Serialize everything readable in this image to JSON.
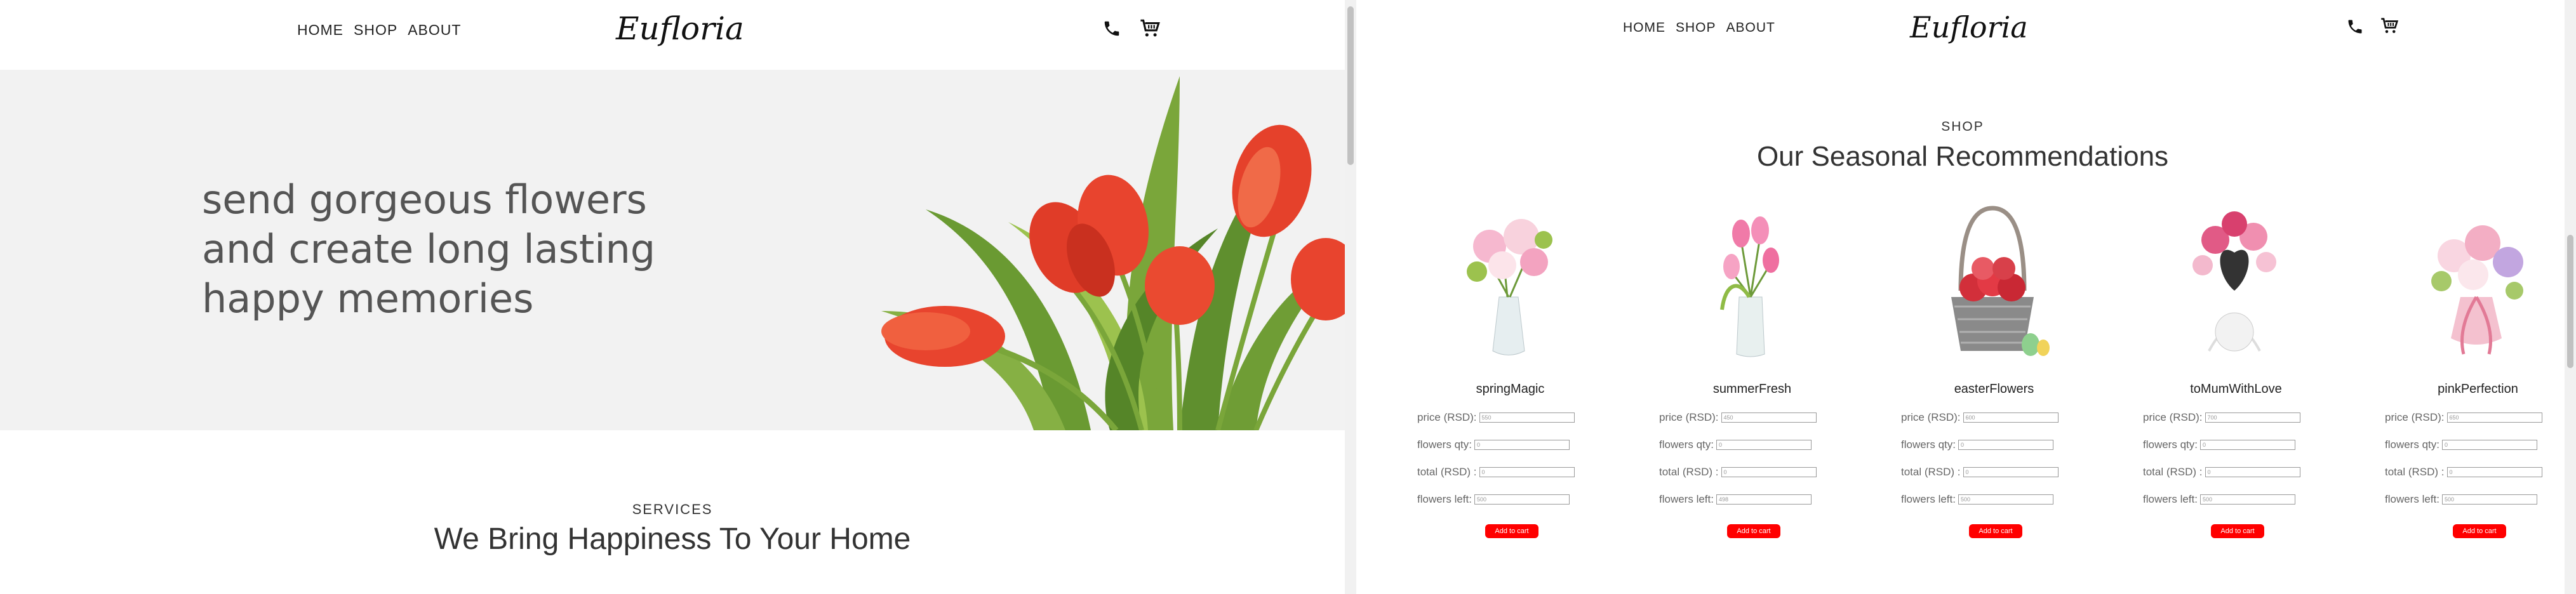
{
  "left": {
    "nav": {
      "links": [
        "HOME",
        "SHOP",
        "ABOUT"
      ],
      "logo": "Eufloria"
    },
    "hero": {
      "lines": [
        "send gorgeous flowers",
        "and create long lasting",
        "happy memories"
      ]
    },
    "services": {
      "label": "SERVICES",
      "title": "We Bring Happiness To Your Home"
    }
  },
  "right": {
    "nav": {
      "links": [
        "HOME",
        "SHOP",
        "ABOUT"
      ],
      "logo": "Eufloria"
    },
    "shop": {
      "label": "SHOP",
      "title": "Our Seasonal Recommendations"
    },
    "field_labels": {
      "price": "price (RSD):",
      "qty": "flowers qty:",
      "total": "total (RSD) :",
      "left": "flowers left:"
    },
    "add_label": "Add to cart",
    "products": [
      {
        "name": "springMagic",
        "price": "550",
        "qty": "0",
        "total": "0",
        "left": "500"
      },
      {
        "name": "summerFresh",
        "price": "450",
        "qty": "0",
        "total": "0",
        "left": "498"
      },
      {
        "name": "easterFlowers",
        "price": "600",
        "qty": "0",
        "total": "0",
        "left": "500"
      },
      {
        "name": "toMumWithLove",
        "price": "700",
        "qty": "0",
        "total": "0",
        "left": "500"
      },
      {
        "name": "pinkPerfection",
        "price": "650",
        "qty": "0",
        "total": "0",
        "left": "500"
      }
    ]
  },
  "icons": [
    "phone-icon",
    "cart-icon"
  ],
  "colors": {
    "accent": "#ff0000",
    "hero_bg": "#f2f2f2",
    "tulip": "#e8442e",
    "leaf": "#5f8f2e"
  }
}
